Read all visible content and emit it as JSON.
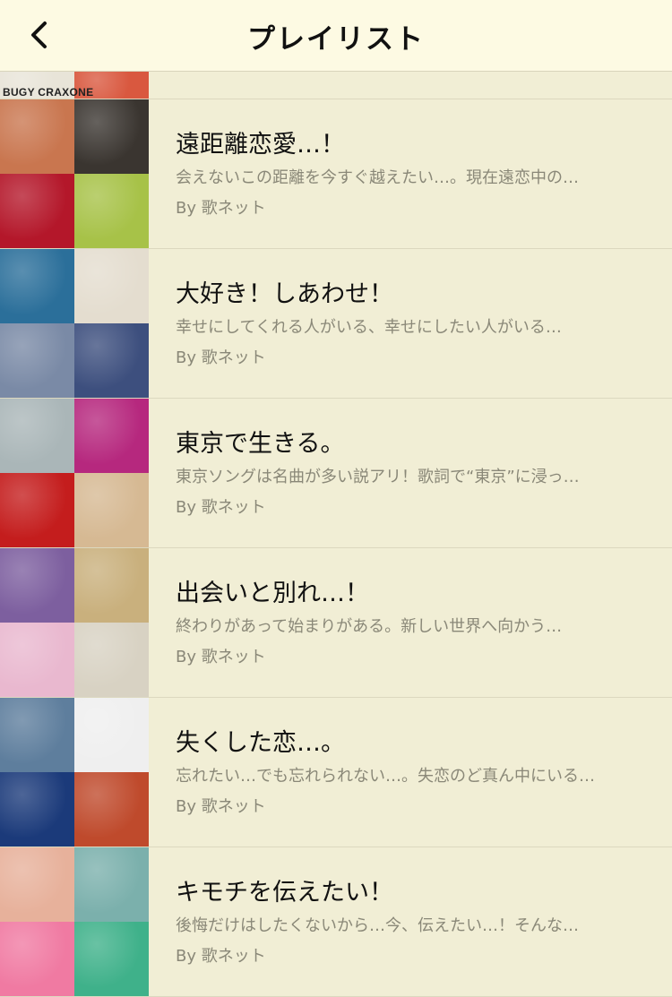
{
  "header": {
    "title": "プレイリスト",
    "back_icon": "chevron-left-icon"
  },
  "partial_item": {
    "caption": "BUGY CRAXONE",
    "tile_colors": [
      "#e8e4d8",
      "#d9583f"
    ]
  },
  "playlists": [
    {
      "title": "遠距離恋愛…！",
      "description": "会えないこの距離を今すぐ越えたい…。現在遠恋中の…",
      "author": "By 歌ネット",
      "tile_colors": [
        "#c9764f",
        "#3a3530",
        "#b4172a",
        "#a7c248"
      ]
    },
    {
      "title": "大好き！しあわせ！",
      "description": "幸せにしてくれる人がいる、幸せにしたい人がいる…",
      "author": "By 歌ネット",
      "tile_colors": [
        "#2b6f9a",
        "#e4ddcf",
        "#7a8aa6",
        "#3d4f7e"
      ]
    },
    {
      "title": "東京で生きる。",
      "description": "東京ソングは名曲が多い説アリ！歌詞で“東京”に浸っ…",
      "author": "By 歌ネット",
      "tile_colors": [
        "#aab6b8",
        "#b6287e",
        "#c41d1d",
        "#d6b993"
      ]
    },
    {
      "title": "出会いと別れ…！",
      "description": "終わりがあって始まりがある。新しい世界へ向かう…",
      "author": "By 歌ネット",
      "tile_colors": [
        "#7d5f9f",
        "#c9b07d",
        "#e9b8cf",
        "#d8d2c3"
      ]
    },
    {
      "title": "失くした恋…。",
      "description": "忘れたい…でも忘れられない…。失恋のど真ん中にいる…",
      "author": "By 歌ネット",
      "tile_colors": [
        "#5e7e9d",
        "#efefef",
        "#1b3a7a",
        "#bf4a2c"
      ]
    },
    {
      "title": "キモチを伝えたい！",
      "description": "後悔だけはしたくないから…今、伝えたい…！そんな…",
      "author": "By 歌ネット",
      "tile_colors": [
        "#e7b19b",
        "#7bb0ac",
        "#f07aa2",
        "#3fb18a"
      ]
    }
  ]
}
